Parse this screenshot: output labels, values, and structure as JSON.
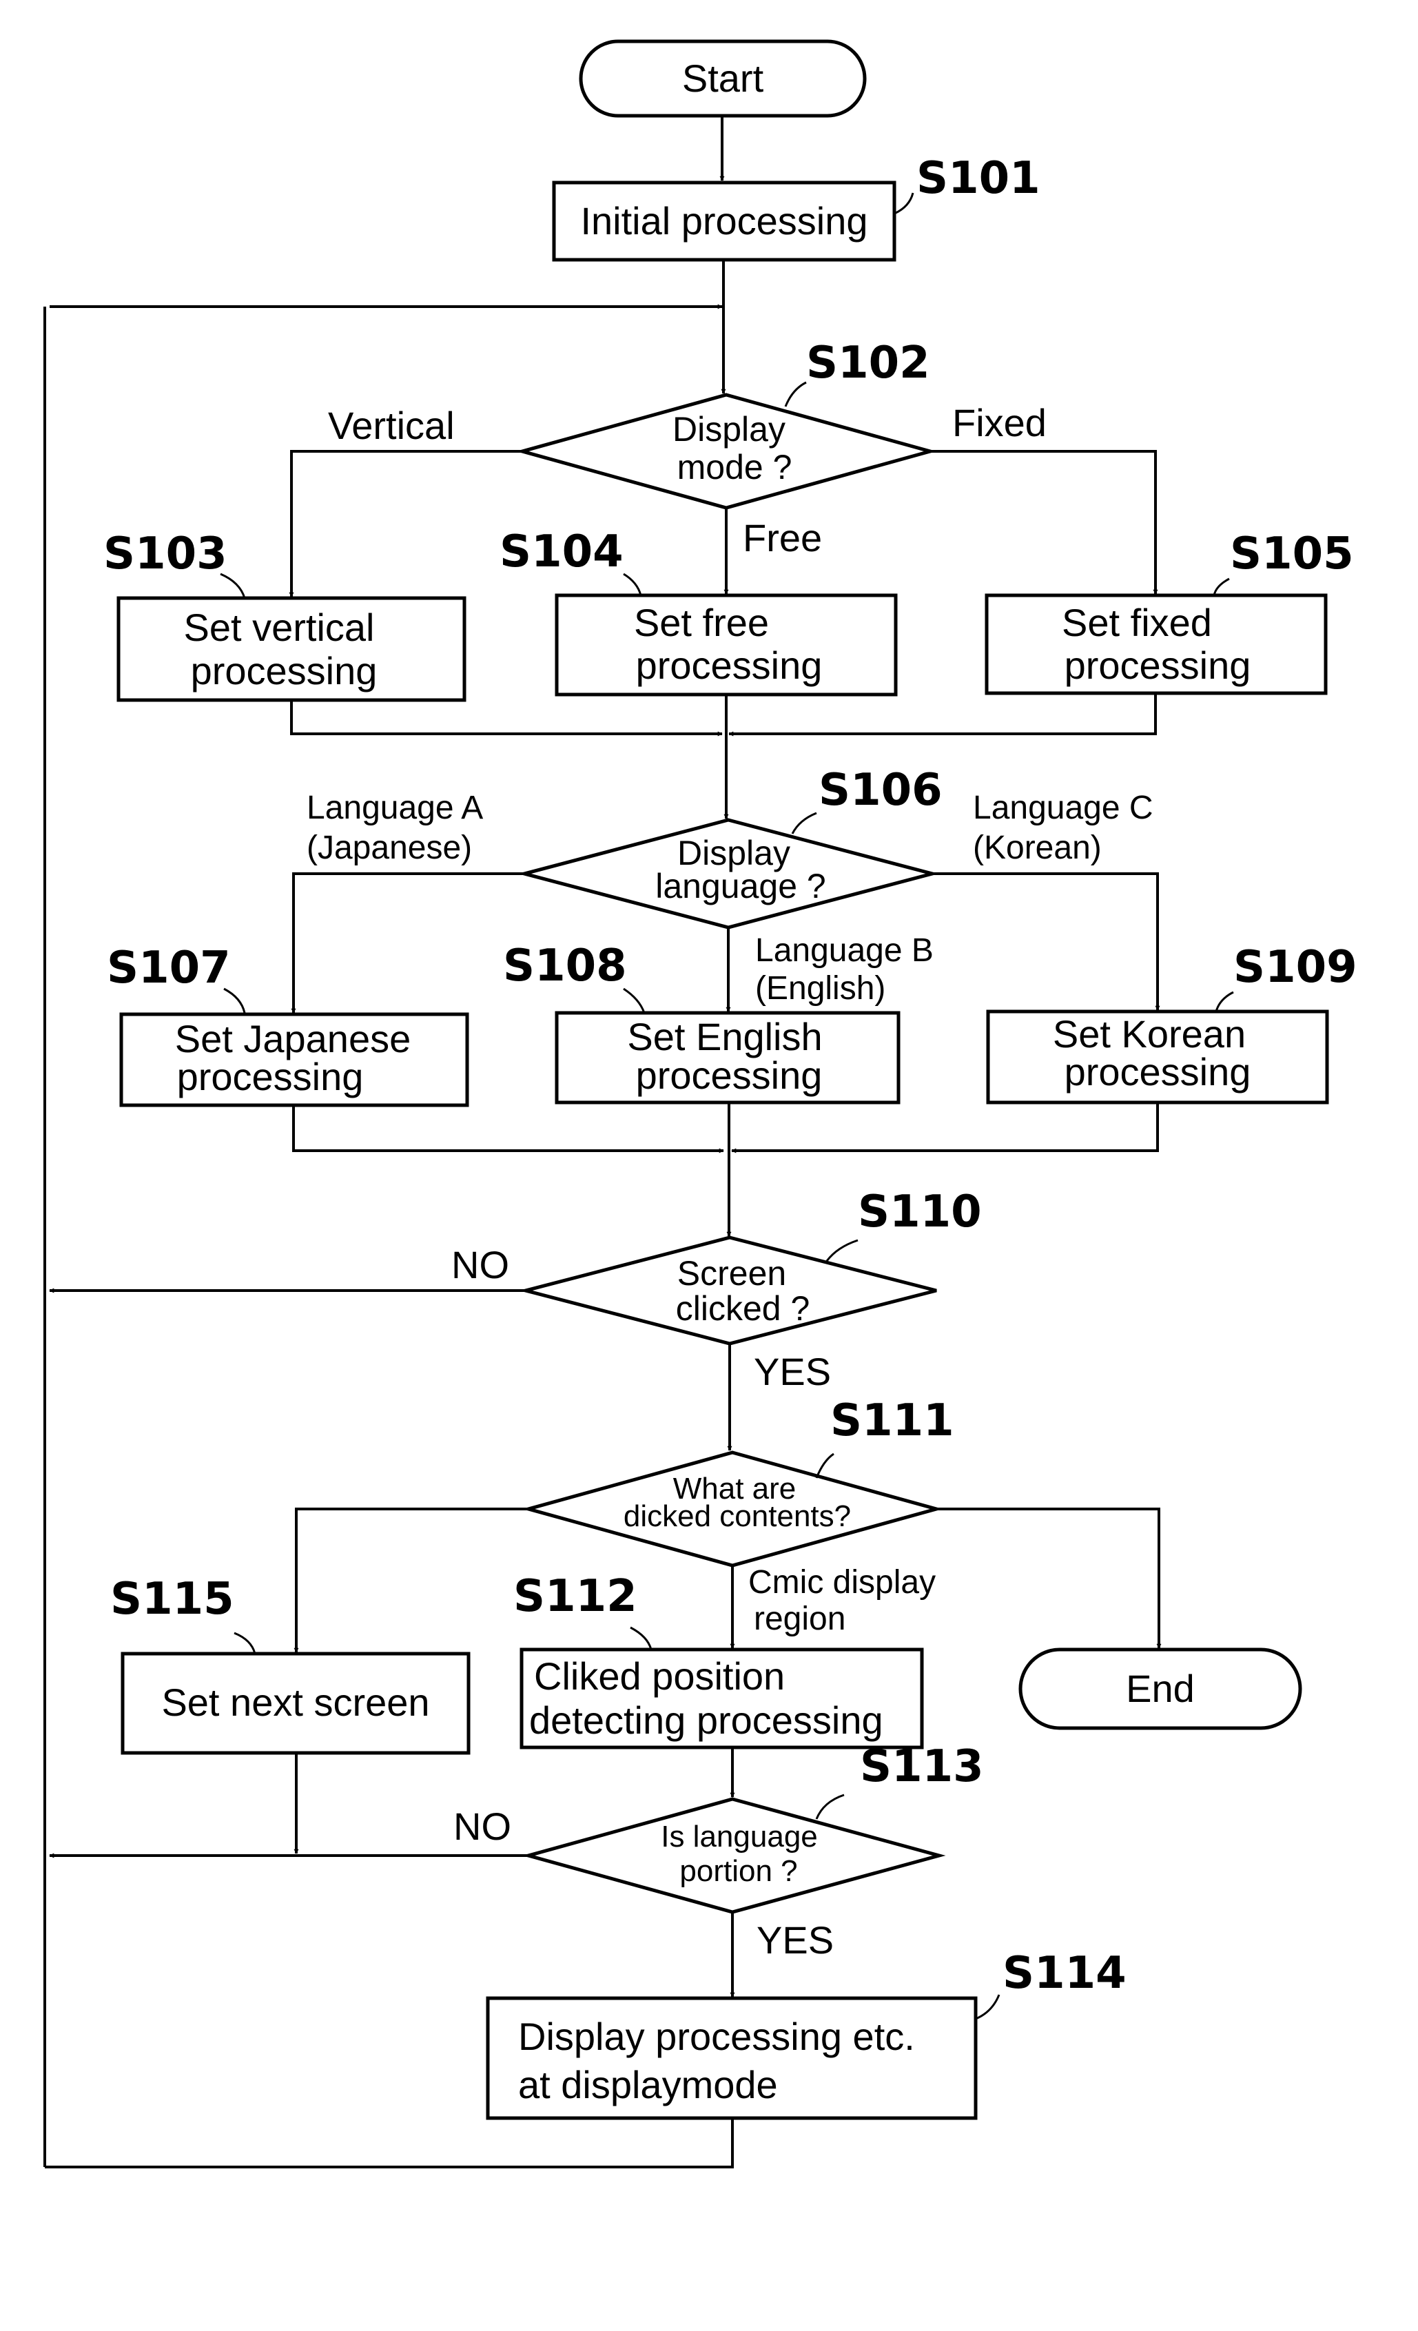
{
  "diagram": {
    "type": "flowchart",
    "nodes": {
      "start": {
        "label": "Start",
        "shape": "terminal"
      },
      "s101": {
        "step": "S101",
        "lines": [
          "Initial processing"
        ],
        "shape": "process"
      },
      "s102": {
        "step": "S102",
        "lines": [
          "Display",
          "mode ?"
        ],
        "shape": "decision"
      },
      "s103": {
        "step": "S103",
        "lines": [
          "Set  vertical",
          "processing"
        ],
        "shape": "process"
      },
      "s104": {
        "step": "S104",
        "lines": [
          "Set free",
          "processing"
        ],
        "shape": "process"
      },
      "s105": {
        "step": "S105",
        "lines": [
          "Set fixed",
          "processing"
        ],
        "shape": "process"
      },
      "s106": {
        "step": "S106",
        "lines": [
          "Display",
          "language ?"
        ],
        "shape": "decision"
      },
      "s107": {
        "step": "S107",
        "lines": [
          "Set Japanese",
          "processing"
        ],
        "shape": "process"
      },
      "s108": {
        "step": "S108",
        "lines": [
          "Set English",
          "processing"
        ],
        "shape": "process"
      },
      "s109": {
        "step": "S109",
        "lines": [
          "Set Korean",
          "processing"
        ],
        "shape": "process"
      },
      "s110": {
        "step": "S110",
        "lines": [
          "Screen",
          "clicked ?"
        ],
        "shape": "decision"
      },
      "s111": {
        "step": "S111",
        "lines": [
          "What are",
          "dicked contents?"
        ],
        "shape": "decision"
      },
      "s112": {
        "step": "S112",
        "lines": [
          "Cliked position",
          "detecting processing"
        ],
        "shape": "process"
      },
      "s113": {
        "step": "S113",
        "lines": [
          "Is language",
          "portion ?"
        ],
        "shape": "decision"
      },
      "s114": {
        "step": "S114",
        "lines": [
          "Display processing etc.",
          "at displaymode"
        ],
        "shape": "process"
      },
      "s115": {
        "step": "S115",
        "lines": [
          "Set next screen"
        ],
        "shape": "process"
      },
      "end": {
        "label": "End",
        "shape": "terminal"
      }
    },
    "branch_labels": {
      "s102_left": "Vertical",
      "s102_right": "Fixed",
      "s102_down": "Free",
      "s106_left": [
        "Language A",
        "(Japanese)"
      ],
      "s106_right": [
        "Language C",
        "(Korean)"
      ],
      "s106_down": [
        "Language B",
        "(English)"
      ],
      "s110_no": "NO",
      "s110_yes": "YES",
      "s111_down": [
        "Cmic display",
        "region"
      ],
      "s113_no": "NO",
      "s113_yes": "YES"
    },
    "edges": [
      {
        "from": "start",
        "to": "s101"
      },
      {
        "from": "s101",
        "to": "s102"
      },
      {
        "from": "s102",
        "to": "s103",
        "label": "Vertical"
      },
      {
        "from": "s102",
        "to": "s104",
        "label": "Free"
      },
      {
        "from": "s102",
        "to": "s105",
        "label": "Fixed"
      },
      {
        "from": "s103",
        "to": "s106"
      },
      {
        "from": "s104",
        "to": "s106"
      },
      {
        "from": "s105",
        "to": "s106"
      },
      {
        "from": "s106",
        "to": "s107",
        "label": "Language A (Japanese)"
      },
      {
        "from": "s106",
        "to": "s108",
        "label": "Language B (English)"
      },
      {
        "from": "s106",
        "to": "s109",
        "label": "Language C (Korean)"
      },
      {
        "from": "s107",
        "to": "s110"
      },
      {
        "from": "s108",
        "to": "s110"
      },
      {
        "from": "s109",
        "to": "s110"
      },
      {
        "from": "s110",
        "to": "s102",
        "label": "NO"
      },
      {
        "from": "s110",
        "to": "s111",
        "label": "YES"
      },
      {
        "from": "s111",
        "to": "s115"
      },
      {
        "from": "s111",
        "to": "s112",
        "label": "Cmic display region"
      },
      {
        "from": "s111",
        "to": "end"
      },
      {
        "from": "s112",
        "to": "s113"
      },
      {
        "from": "s113",
        "to": "s102",
        "label": "NO"
      },
      {
        "from": "s113",
        "to": "s114",
        "label": "YES"
      },
      {
        "from": "s115",
        "to": "s102"
      },
      {
        "from": "s114",
        "to": "s102"
      }
    ]
  }
}
